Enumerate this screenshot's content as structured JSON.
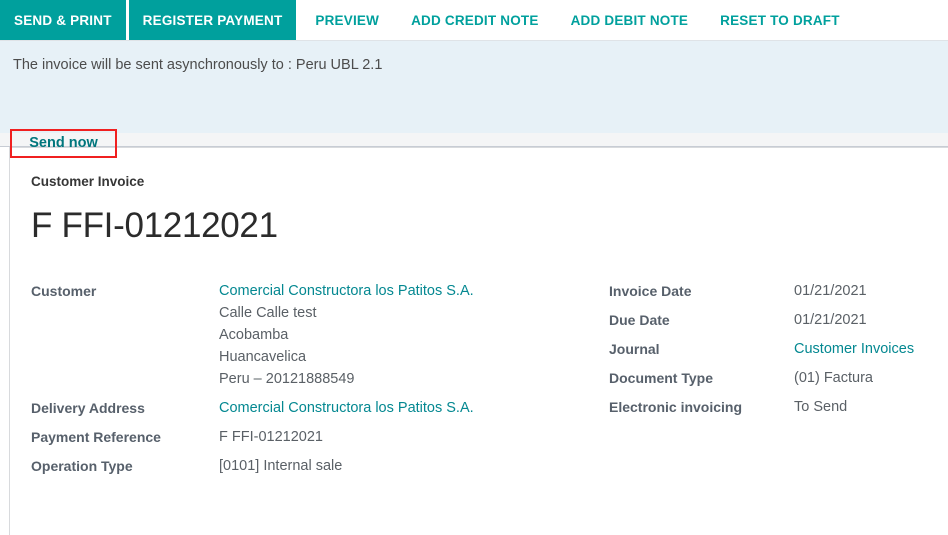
{
  "toolbar": {
    "primary_buttons": [
      {
        "label": "SEND & PRINT",
        "name": "send-and-print"
      },
      {
        "label": "REGISTER PAYMENT",
        "name": "register-payment"
      }
    ],
    "link_buttons": [
      {
        "label": "PREVIEW",
        "name": "preview"
      },
      {
        "label": "ADD CREDIT NOTE",
        "name": "add-credit-note"
      },
      {
        "label": "ADD DEBIT NOTE",
        "name": "add-debit-note"
      },
      {
        "label": "RESET TO DRAFT",
        "name": "reset-to-draft"
      }
    ]
  },
  "banner": {
    "message": "The invoice will be sent asynchronously to : Peru UBL 2.1",
    "send_now_label": "Send now"
  },
  "sheet": {
    "subtitle": "Customer Invoice",
    "title": "F FFI-01212021",
    "left_fields": {
      "customer_label": "Customer",
      "customer_name": "Comercial Constructora los Patitos S.A.",
      "customer_street": "Calle Calle test",
      "customer_city": "Acobamba",
      "customer_state": "Huancavelica",
      "customer_country_vat": "Peru – 20121888549",
      "delivery_address_label": "Delivery Address",
      "delivery_address_value": "Comercial Constructora los Patitos S.A.",
      "payment_reference_label": "Payment Reference",
      "payment_reference_value": "F FFI-01212021",
      "operation_type_label": "Operation Type",
      "operation_type_value": "[0101] Internal sale"
    },
    "right_fields": {
      "invoice_date_label": "Invoice Date",
      "invoice_date_value": "01/21/2021",
      "due_date_label": "Due Date",
      "due_date_value": "01/21/2021",
      "journal_label": "Journal",
      "journal_value": "Customer Invoices",
      "document_type_label": "Document Type",
      "document_type_value": "(01) Factura",
      "electronic_invoicing_label": "Electronic invoicing",
      "electronic_invoicing_value": "To Send"
    }
  },
  "colors": {
    "accent": "#00a09d",
    "link": "#048891",
    "banner_bg": "#e7f1f7",
    "highlight": "#f02020"
  }
}
